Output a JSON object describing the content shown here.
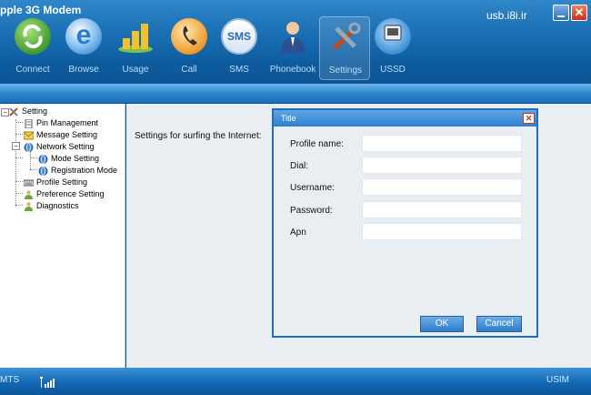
{
  "window": {
    "title": "pple 3G Modem",
    "site_label": "usb.i8i.ir",
    "minimize_label": "",
    "close_label": "✕"
  },
  "toolbar": {
    "items": [
      {
        "label": "Connect",
        "icon": "connect-icon"
      },
      {
        "label": "Browse",
        "icon": "browser-icon"
      },
      {
        "label": "Usage",
        "icon": "bar-chart-icon"
      },
      {
        "label": "Call",
        "icon": "phone-icon"
      },
      {
        "label": "SMS",
        "icon": "sms-icon"
      },
      {
        "label": "Phonebook",
        "icon": "contact-person-icon"
      },
      {
        "label": "Settings",
        "icon": "tools-icon",
        "active": true
      },
      {
        "label": "USSD",
        "icon": "ussd-icon"
      }
    ]
  },
  "tree": {
    "items": [
      {
        "label": "Setting",
        "icon": "settings-tools-icon"
      },
      {
        "label": "Pin Management",
        "icon": "document-icon"
      },
      {
        "label": "Message Setting",
        "icon": "envelope-icon"
      },
      {
        "label": "Network Setting",
        "icon": "globe-icon"
      },
      {
        "label": "Mode Setting",
        "icon": "globe-icon"
      },
      {
        "label": "Registration Mode",
        "icon": "globe-icon"
      },
      {
        "label": "Profile Setting",
        "icon": "keyboard-icon"
      },
      {
        "label": "Preference Setting",
        "icon": "person-icon"
      },
      {
        "label": "Diagnostics",
        "icon": "person-icon"
      }
    ]
  },
  "main": {
    "caption": "Settings for surfing the Internet:"
  },
  "dialog": {
    "title": "Title",
    "close_label": "✕",
    "fields": [
      {
        "label": "Profile name:",
        "value": ""
      },
      {
        "label": "Dial:",
        "value": ""
      },
      {
        "label": "Username:",
        "value": ""
      },
      {
        "label": "Password:",
        "value": ""
      },
      {
        "label": "Apn",
        "value": ""
      }
    ],
    "ok_label": "OK",
    "cancel_label": "Cancel"
  },
  "status": {
    "network": "MTS",
    "signal_icon": "signal-bars-icon",
    "sim": "USIM"
  },
  "colors": {
    "toolbar_blue": "#1b6fb4",
    "dialog_border": "#1d6cc0",
    "panel_bg": "#e9eef3"
  }
}
